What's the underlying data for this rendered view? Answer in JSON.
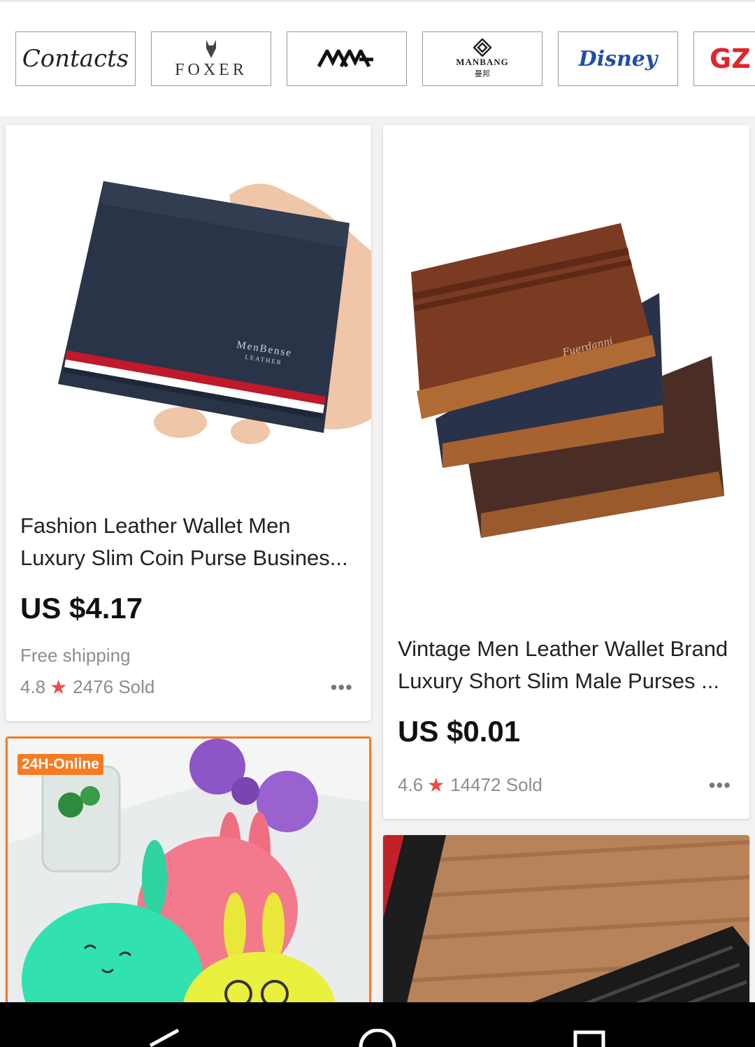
{
  "brands": [
    {
      "name": "Contacts"
    },
    {
      "name": "FOXER"
    },
    {
      "name": "MVA"
    },
    {
      "name": "MANBANG",
      "sub": "曼邦"
    },
    {
      "name": "Disney"
    },
    {
      "name": "GZ"
    }
  ],
  "products": [
    {
      "title": "Fashion Leather Wallet Men Luxury Slim Coin Purse Busines...",
      "price": "US $4.17",
      "shipping": "Free shipping",
      "rating": "4.8",
      "sold": "2476 Sold",
      "wallet_label": "MenBense",
      "wallet_sub": "LEATHER"
    },
    {
      "title": "Vintage Men Leather Wallet Brand Luxury Short Slim Male Purses ...",
      "price": "US $0.01",
      "rating": "4.6",
      "sold": "14472 Sold",
      "wallet_label": "Fuerdanni"
    },
    {
      "badge": "24H-Online"
    },
    {}
  ],
  "colors": {
    "accent_star": "#f04a4a",
    "badge": "#f77b20",
    "card_highlight": "#f77b20"
  }
}
